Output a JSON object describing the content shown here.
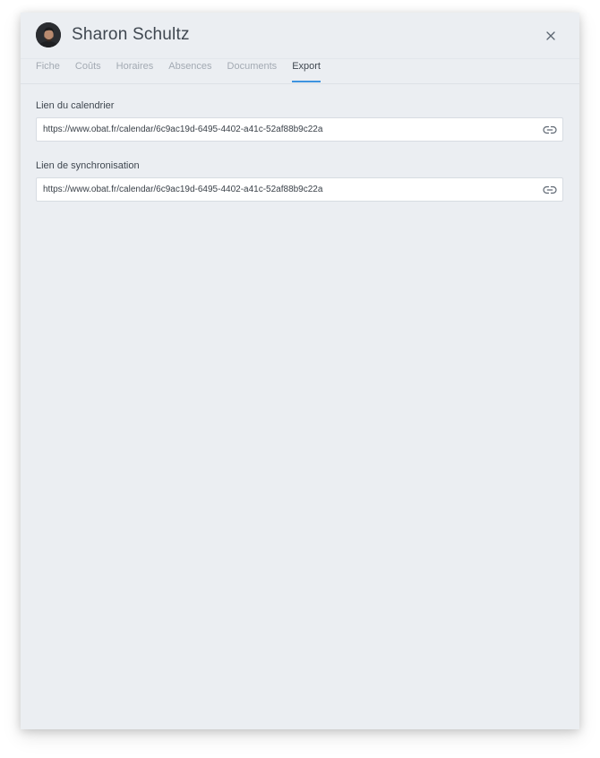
{
  "header": {
    "title": "Sharon Schultz",
    "avatar_icon": "user-avatar-photo",
    "close_icon": "close-icon"
  },
  "tabs": [
    {
      "label": "Fiche",
      "active": false
    },
    {
      "label": "Coûts",
      "active": false
    },
    {
      "label": "Horaires",
      "active": false
    },
    {
      "label": "Absences",
      "active": false
    },
    {
      "label": "Documents",
      "active": false
    },
    {
      "label": "Export",
      "active": true
    }
  ],
  "export": {
    "calendar_label": "Lien du calendrier",
    "calendar_url": "https://www.obat.fr/calendar/6c9ac19d-6495-4402-a41c-52af88b9c22a",
    "sync_label": "Lien de synchronisation",
    "sync_url": "https://www.obat.fr/calendar/6c9ac19d-6495-4402-a41c-52af88b9c22a",
    "link_icon": "link-icon"
  },
  "colors": {
    "accent": "#3d93df",
    "panel_background": "#ebeef2",
    "text_primary": "#3f4750",
    "text_muted": "#a3aab3"
  }
}
